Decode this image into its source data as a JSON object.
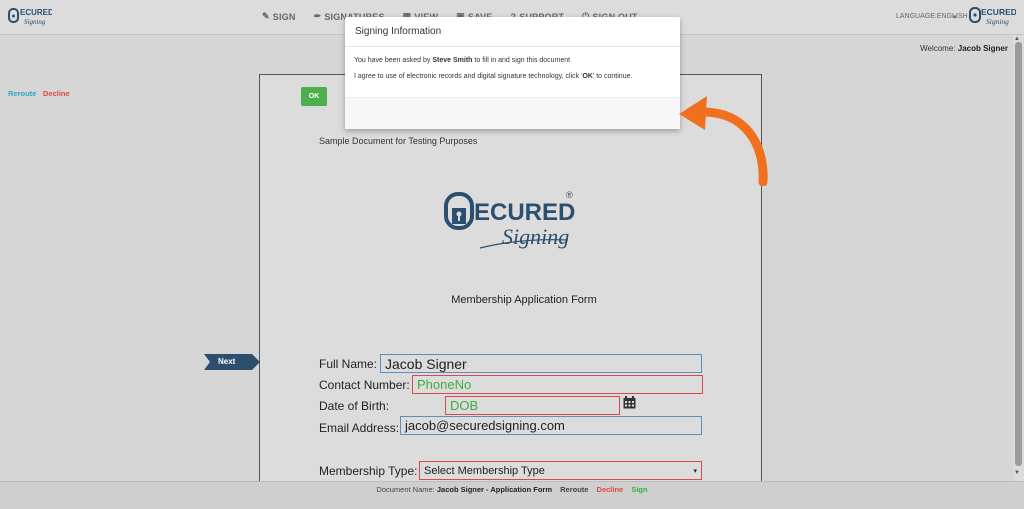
{
  "topbar": {
    "nav": [
      {
        "icon": "sign-icon",
        "label": "SIGN"
      },
      {
        "icon": "pen-icon",
        "label": "SIGNATURES"
      },
      {
        "icon": "view-icon",
        "label": "VIEW"
      },
      {
        "icon": "save-icon",
        "label": "SAVE"
      },
      {
        "icon": "support-icon",
        "label": "SUPPORT"
      },
      {
        "icon": "signout-icon",
        "label": "SIGN OUT"
      }
    ],
    "language": "LANGUAGE:ENGLISH"
  },
  "welcome": {
    "prefix": "Welcome:",
    "name": "Jacob Signer"
  },
  "document": {
    "subtitle": "Sample Document for Testing Purposes",
    "form_title": "Membership Application Form",
    "next_label": "Next",
    "fields": {
      "full_name": {
        "label": "Full Name:",
        "value": "Jacob Signer"
      },
      "contact": {
        "label": "Contact Number:",
        "value": "PhoneNo"
      },
      "dob": {
        "label": "Date of Birth:",
        "value": "DOB"
      },
      "email": {
        "label": "Email Address:",
        "value": "jacob@securedsigning.com"
      },
      "membership": {
        "label": "Membership Type:",
        "value": "Select Membership Type"
      }
    }
  },
  "modal": {
    "title": "Signing Information",
    "line1_pre": "You have been asked by",
    "line1_name": "Steve Smith",
    "line1_post": "to fill in and sign this document",
    "line2_pre": "I agree to use of electronic records and digital signature technology, click '",
    "line2_ok": "OK",
    "line2_post": "' to continue.",
    "reroute": "Reroute",
    "decline": "Decline",
    "ok": "OK"
  },
  "bottombar": {
    "doc_label": "Document Name:",
    "doc_name": "Jacob Signer - Application Form",
    "reroute": "Reroute",
    "decline": "Decline",
    "sign": "Sign"
  },
  "colors": {
    "accent_green": "#4cae4c",
    "decline_red": "#e04848",
    "reroute_teal": "#2ba8c0",
    "arrow_orange": "#f07020",
    "logo_navy": "#2d4f6e"
  }
}
